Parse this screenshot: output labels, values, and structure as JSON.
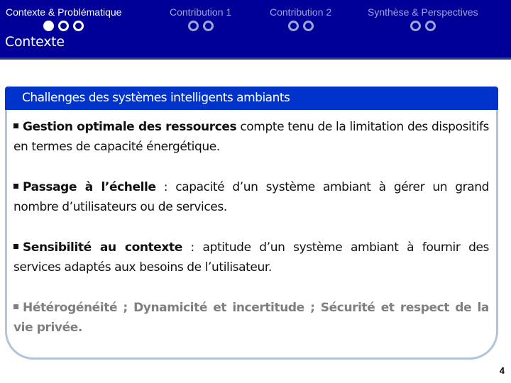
{
  "header": {
    "sections": [
      {
        "label": "Contexte & Problématique",
        "active": true,
        "dots": [
          true,
          false,
          false
        ]
      },
      {
        "label": "Contribution 1",
        "active": false,
        "dots": [
          false,
          false
        ]
      },
      {
        "label": "Contribution 2",
        "active": false,
        "dots": [
          false,
          false
        ]
      },
      {
        "label": "Synthèse & Perspectives",
        "active": false,
        "dots": [
          false,
          false
        ]
      }
    ],
    "title": "Contexte"
  },
  "box": {
    "title": "Challenges des systèmes intelligents ambiants",
    "bullets": [
      {
        "bold": "Gestion optimale des ressources",
        "text": " compte tenu de la limitation des dispositifs en termes de capacité énergétique."
      },
      {
        "bold": "Passage à l’échelle",
        "text": " : capacité d’un système ambiant à gérer un grand nombre d’utilisateurs ou de services."
      },
      {
        "bold": "Sensibilité au contexte",
        "text": " : aptitude d’un système ambiant à fournir des services adaptés aux besoins de l’utilisateur."
      },
      {
        "bold": "",
        "text": "Hétérogénéité ; Dynamicité et incertitude ;  Sécurité et respect de la vie privée."
      }
    ]
  },
  "footer": {
    "page_number": "4"
  },
  "colors": {
    "header_bg": "#000099",
    "box_header_bg": "#0033cc",
    "box_border": "#b3c3dd",
    "inactive_nav": "#9fa4d8",
    "muted_text": "#7f7f7f"
  }
}
